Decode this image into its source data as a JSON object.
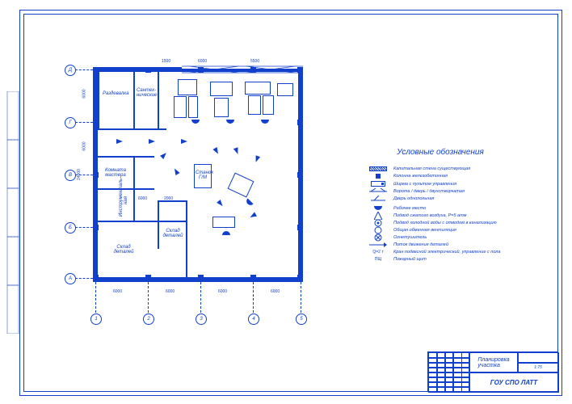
{
  "drawing": {
    "title": "Планировка участка",
    "legend_title": "Условные обозначения",
    "institution": "ГОУ СПО ЛАТТ",
    "scale_hint": "1:75"
  },
  "rooms": {
    "razdevalka": "Раздевалка",
    "santex": "Сантех-\nнические",
    "komnata_mastera": "Комната\nмастера",
    "instrumentalnaya": "Инструменталь-\nная",
    "sklad_detaley1": "Склад\nдеталей",
    "sklad_detaley2": "Склад\nдеталей",
    "stanok": "Станок\nГ/М"
  },
  "dimensions": {
    "top_bay1": "1500",
    "top_bay2": "6000",
    "top_bay3": "5500",
    "left_seg1": "6000",
    "left_seg2": "6000",
    "left_total": "24000",
    "mid1": "6000",
    "mid2": "2000",
    "bottom1": "6000",
    "bottom2": "6000",
    "bottom3": "6000",
    "bottom4": "6000"
  },
  "axes": {
    "nums": [
      "1",
      "2",
      "3",
      "4",
      "5"
    ],
    "letters": [
      "А",
      "Б",
      "В",
      "Г",
      "Д"
    ]
  },
  "legend": [
    {
      "sym": "wall-cap",
      "label": "Капитальная стена существующая"
    },
    {
      "sym": "column",
      "label": "Колонна железобетонная"
    },
    {
      "sym": "screen",
      "label": "Ширма с пультом управления"
    },
    {
      "sym": "gate",
      "label": "Ворота / дверь / двухстворчатая"
    },
    {
      "sym": "door",
      "label": "Дверь однопольная"
    },
    {
      "sym": "workplc",
      "label": "Рабочее место"
    },
    {
      "sym": "air",
      "label": "Подвод сжатого воздуха, P=5 атм"
    },
    {
      "sym": "water",
      "label": "Подвод холодной воды с отводом в канализацию"
    },
    {
      "sym": "vent",
      "label": "Общая обменная вентиляция"
    },
    {
      "sym": "extin",
      "label": "Огнетушитель"
    },
    {
      "sym": "flow",
      "label": "Поток движения деталей"
    },
    {
      "sym": "crane",
      "label": "Кран подвесной электрический, управление с пола",
      "prefix": "Q=2 т"
    },
    {
      "sym": "fire",
      "label": "Пожарный щит",
      "prefix": "ПЩ"
    }
  ],
  "titleblock": {
    "main_title": "Планировка\nучастка",
    "org": "ГОУ СПО ЛАТТ",
    "scale": "1:75"
  }
}
